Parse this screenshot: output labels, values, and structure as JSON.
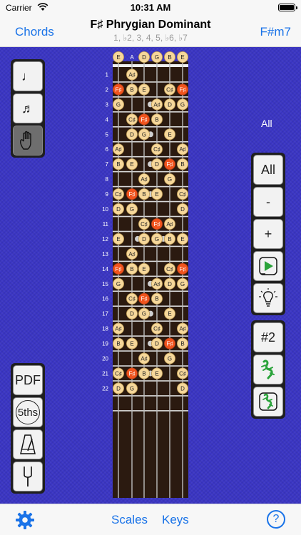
{
  "status": {
    "carrier": "Carrier",
    "time": "10:31 AM"
  },
  "nav": {
    "left": "Chords",
    "right": "F#m7",
    "title": "F♯ Phrygian Dominant",
    "subtitle": "1, ♭2, 3, 4, 5, ♭6, ♭7"
  },
  "left_tools": {
    "note_icon": "♩",
    "notes_icon": "♬",
    "hand_icon": "hand-icon"
  },
  "left_bottom_tools": {
    "pdf": "PDF",
    "fifths": "5ths"
  },
  "right_tools": {
    "all": "All",
    "minus": "-",
    "plus": "+"
  },
  "right_bottom_tools": {
    "position": "#2"
  },
  "side_label": "All",
  "strings_open": [
    "E",
    "A",
    "D",
    "G",
    "B",
    "E"
  ],
  "fret_numbers": [
    "1",
    "2",
    "3",
    "4",
    "5",
    "6",
    "7",
    "8",
    "9",
    "10",
    "11",
    "12",
    "13",
    "14",
    "15",
    "16",
    "17",
    "18",
    "19",
    "20",
    "21",
    "22"
  ],
  "fretboard": {
    "notes": [
      {
        "f": 0,
        "s": 0,
        "n": "E"
      },
      {
        "f": 0,
        "s": 2,
        "n": "D"
      },
      {
        "f": 0,
        "s": 3,
        "n": "G"
      },
      {
        "f": 0,
        "s": 4,
        "n": "B"
      },
      {
        "f": 0,
        "s": 5,
        "n": "E"
      },
      {
        "f": 1,
        "s": 1,
        "n": "A♯"
      },
      {
        "f": 2,
        "s": 0,
        "n": "F♯",
        "r": true
      },
      {
        "f": 2,
        "s": 1,
        "n": "B"
      },
      {
        "f": 2,
        "s": 2,
        "n": "E"
      },
      {
        "f": 2,
        "s": 4,
        "n": "C♯"
      },
      {
        "f": 2,
        "s": 5,
        "n": "F♯",
        "r": true
      },
      {
        "f": 3,
        "s": 0,
        "n": "G"
      },
      {
        "f": 3,
        "s": 3,
        "n": "A♯"
      },
      {
        "f": 3,
        "s": 4,
        "n": "D"
      },
      {
        "f": 3,
        "s": 5,
        "n": "G"
      },
      {
        "f": 4,
        "s": 1,
        "n": "C♯"
      },
      {
        "f": 4,
        "s": 2,
        "n": "F♯",
        "r": true
      },
      {
        "f": 4,
        "s": 3,
        "n": "B"
      },
      {
        "f": 5,
        "s": 1,
        "n": "D"
      },
      {
        "f": 5,
        "s": 2,
        "n": "G"
      },
      {
        "f": 5,
        "s": 4,
        "n": "E"
      },
      {
        "f": 6,
        "s": 0,
        "n": "A♯"
      },
      {
        "f": 6,
        "s": 3,
        "n": "C♯"
      },
      {
        "f": 6,
        "s": 5,
        "n": "A♯"
      },
      {
        "f": 7,
        "s": 0,
        "n": "B"
      },
      {
        "f": 7,
        "s": 1,
        "n": "E"
      },
      {
        "f": 7,
        "s": 3,
        "n": "D"
      },
      {
        "f": 7,
        "s": 4,
        "n": "F♯",
        "r": true
      },
      {
        "f": 7,
        "s": 5,
        "n": "B"
      },
      {
        "f": 8,
        "s": 2,
        "n": "A♯"
      },
      {
        "f": 8,
        "s": 4,
        "n": "G"
      },
      {
        "f": 9,
        "s": 0,
        "n": "C♯"
      },
      {
        "f": 9,
        "s": 1,
        "n": "F♯",
        "r": true
      },
      {
        "f": 9,
        "s": 2,
        "n": "B"
      },
      {
        "f": 9,
        "s": 3,
        "n": "E"
      },
      {
        "f": 9,
        "s": 5,
        "n": "C♯"
      },
      {
        "f": 10,
        "s": 0,
        "n": "D"
      },
      {
        "f": 10,
        "s": 1,
        "n": "G"
      },
      {
        "f": 10,
        "s": 5,
        "n": "D"
      },
      {
        "f": 11,
        "s": 2,
        "n": "C♯"
      },
      {
        "f": 11,
        "s": 3,
        "n": "F♯",
        "r": true
      },
      {
        "f": 11,
        "s": 4,
        "n": "A♯"
      },
      {
        "f": 12,
        "s": 0,
        "n": "E"
      },
      {
        "f": 12,
        "s": 2,
        "n": "D"
      },
      {
        "f": 12,
        "s": 3,
        "n": "G"
      },
      {
        "f": 12,
        "s": 4,
        "n": "B"
      },
      {
        "f": 12,
        "s": 5,
        "n": "E"
      },
      {
        "f": 13,
        "s": 1,
        "n": "A♯"
      },
      {
        "f": 14,
        "s": 0,
        "n": "F♯",
        "r": true
      },
      {
        "f": 14,
        "s": 1,
        "n": "B"
      },
      {
        "f": 14,
        "s": 2,
        "n": "E"
      },
      {
        "f": 14,
        "s": 4,
        "n": "C♯"
      },
      {
        "f": 14,
        "s": 5,
        "n": "F♯",
        "r": true
      },
      {
        "f": 15,
        "s": 0,
        "n": "G"
      },
      {
        "f": 15,
        "s": 3,
        "n": "A♯"
      },
      {
        "f": 15,
        "s": 4,
        "n": "D"
      },
      {
        "f": 15,
        "s": 5,
        "n": "G"
      },
      {
        "f": 16,
        "s": 1,
        "n": "C♯"
      },
      {
        "f": 16,
        "s": 2,
        "n": "F♯",
        "r": true
      },
      {
        "f": 16,
        "s": 3,
        "n": "B"
      },
      {
        "f": 17,
        "s": 1,
        "n": "D"
      },
      {
        "f": 17,
        "s": 2,
        "n": "G"
      },
      {
        "f": 17,
        "s": 4,
        "n": "E"
      },
      {
        "f": 18,
        "s": 0,
        "n": "A♯"
      },
      {
        "f": 18,
        "s": 3,
        "n": "C♯"
      },
      {
        "f": 18,
        "s": 5,
        "n": "A♯"
      },
      {
        "f": 19,
        "s": 0,
        "n": "B"
      },
      {
        "f": 19,
        "s": 1,
        "n": "E"
      },
      {
        "f": 19,
        "s": 3,
        "n": "D"
      },
      {
        "f": 19,
        "s": 4,
        "n": "F♯",
        "r": true
      },
      {
        "f": 19,
        "s": 5,
        "n": "B"
      },
      {
        "f": 20,
        "s": 2,
        "n": "A♯"
      },
      {
        "f": 20,
        "s": 4,
        "n": "G"
      },
      {
        "f": 21,
        "s": 0,
        "n": "C♯"
      },
      {
        "f": 21,
        "s": 1,
        "n": "F♯",
        "r": true
      },
      {
        "f": 21,
        "s": 2,
        "n": "B"
      },
      {
        "f": 21,
        "s": 3,
        "n": "E"
      },
      {
        "f": 21,
        "s": 5,
        "n": "C♯"
      },
      {
        "f": 22,
        "s": 0,
        "n": "D"
      },
      {
        "f": 22,
        "s": 1,
        "n": "G"
      },
      {
        "f": 22,
        "s": 5,
        "n": "D"
      }
    ]
  },
  "tabs": {
    "scales": "Scales",
    "keys": "Keys",
    "help": "?"
  },
  "colors": {
    "accent": "#1a73e8",
    "background": "#3a35c4",
    "note": "#f6d79a",
    "root_note": "#f0541e",
    "fret_wood": "#2b1a10",
    "fret_wire": "#d9d9d9"
  }
}
